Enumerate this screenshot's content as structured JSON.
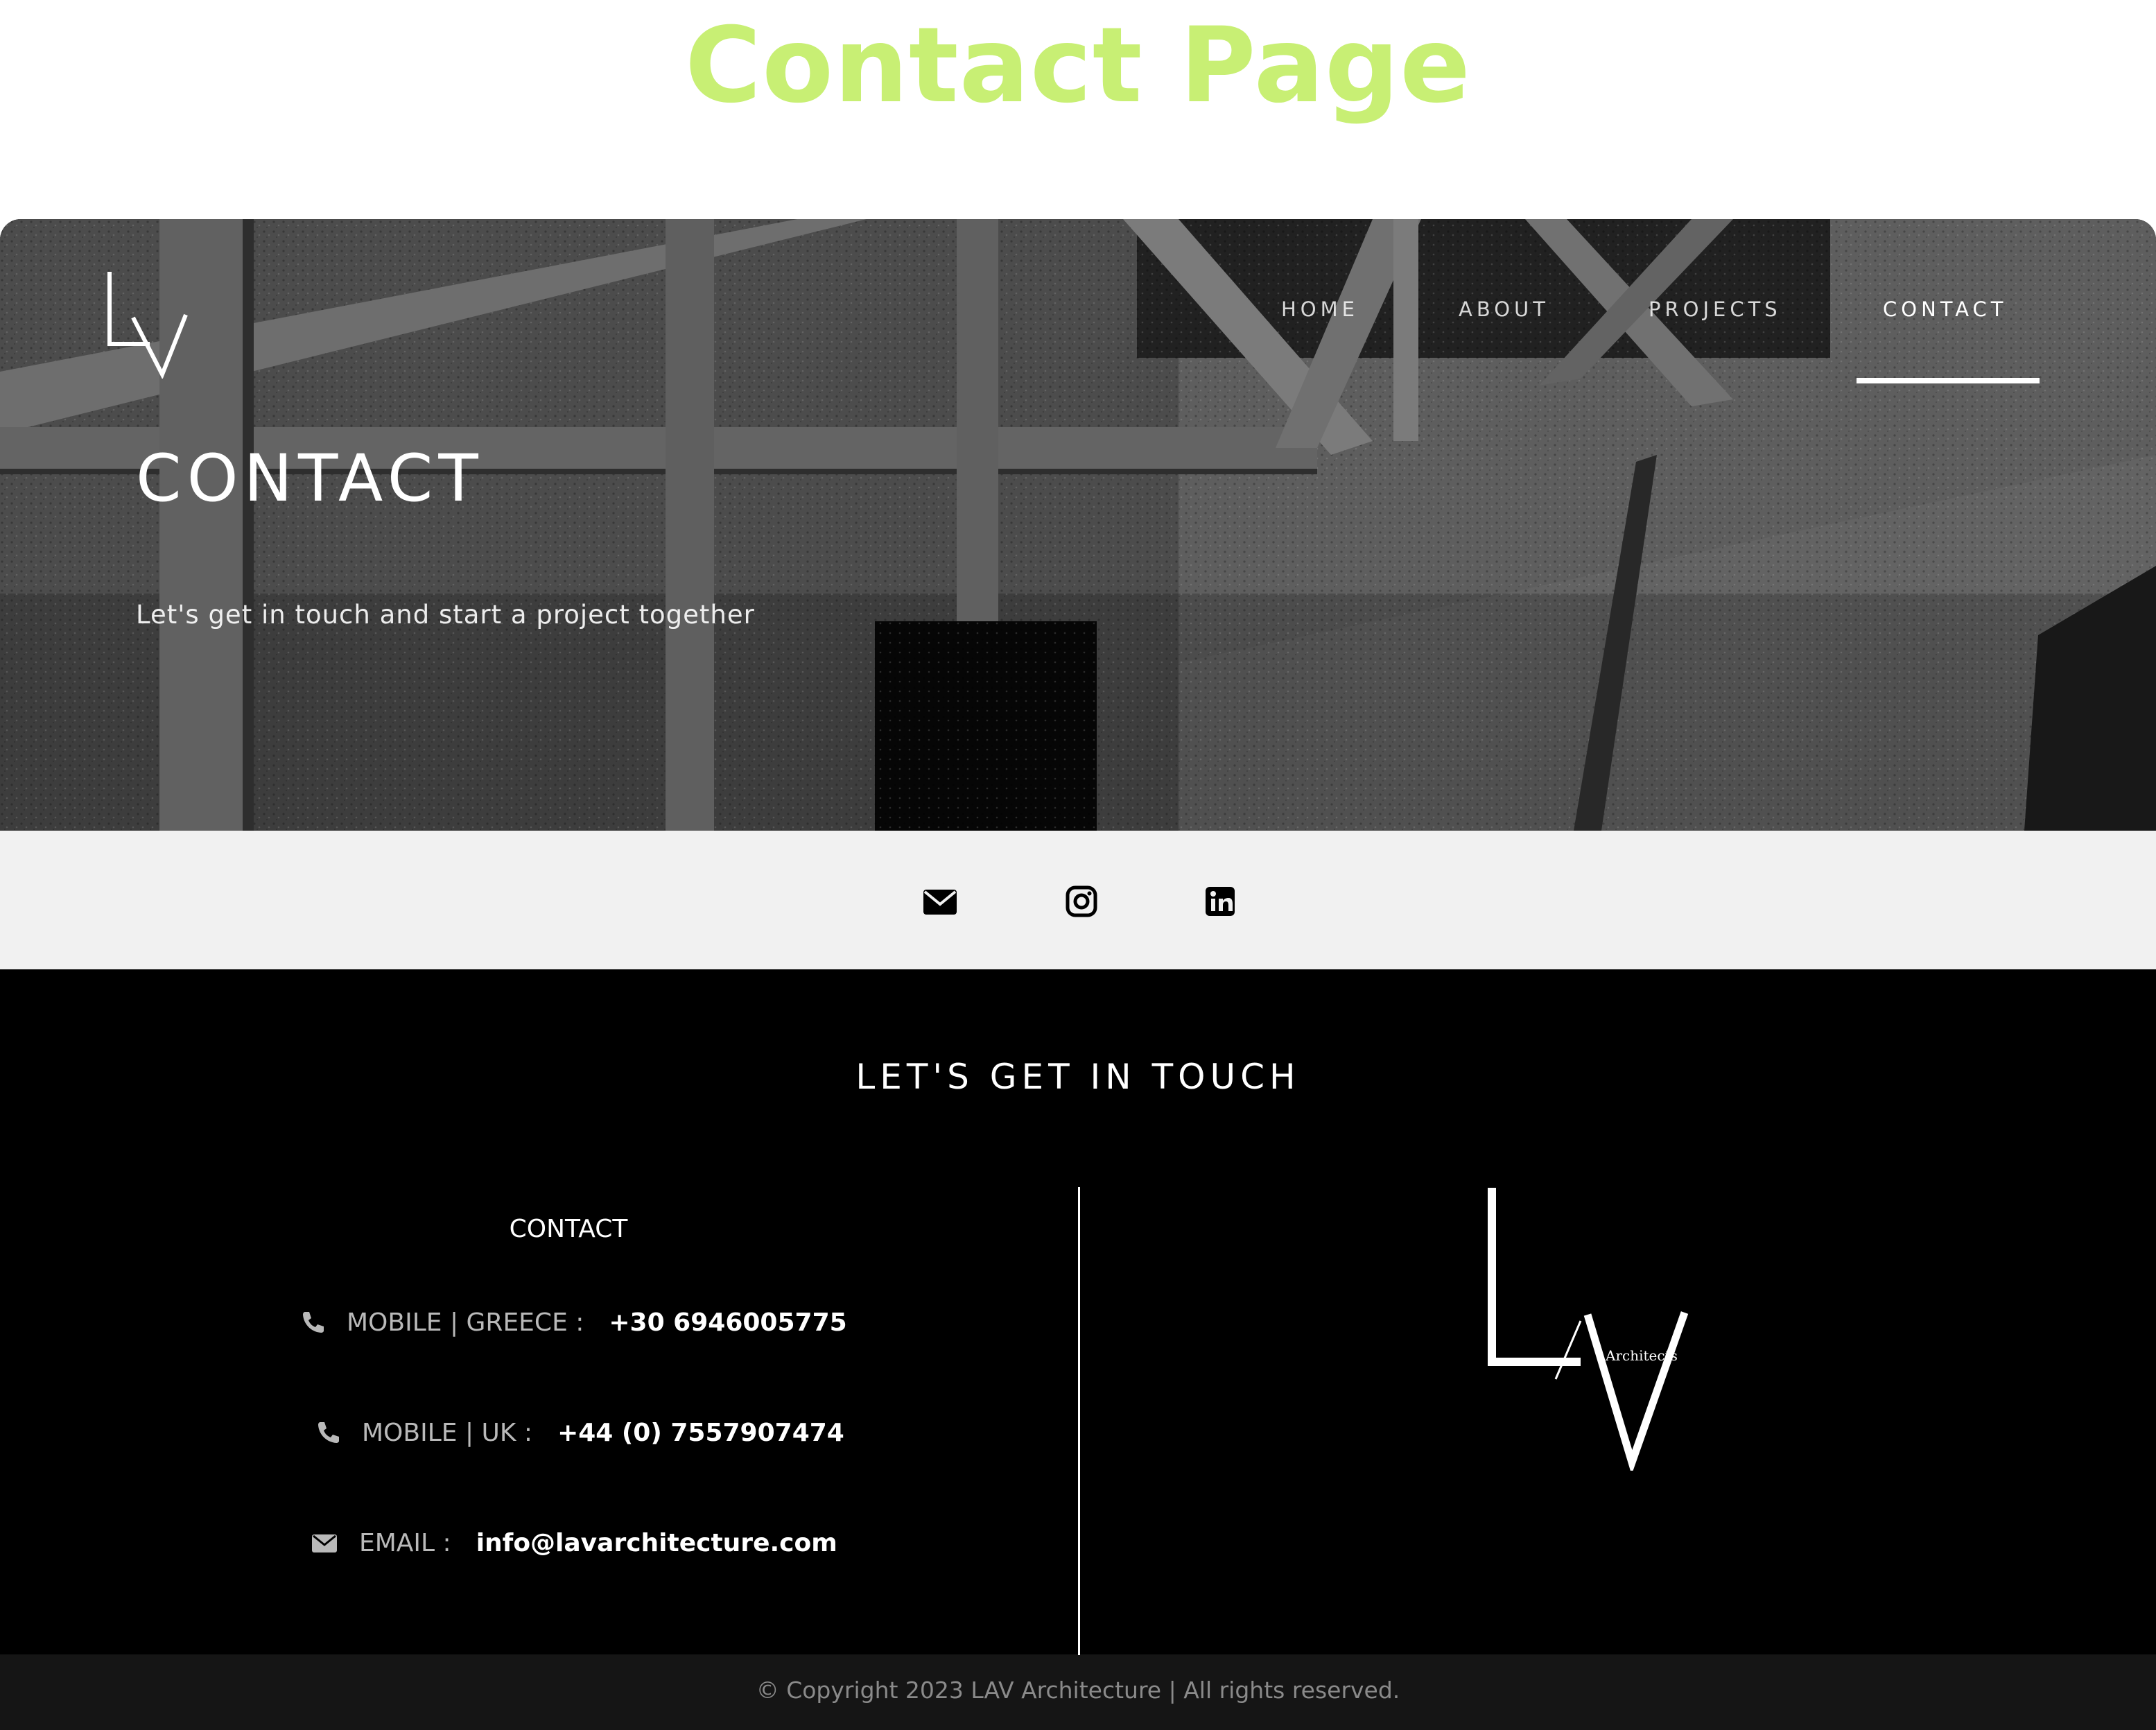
{
  "page_heading": "Contact Page",
  "brand": {
    "logo_letters": "LV",
    "logo_subtext": "Architects"
  },
  "nav": {
    "items": [
      {
        "label": "HOME"
      },
      {
        "label": "ABOUT"
      },
      {
        "label": "PROJECTS"
      },
      {
        "label": "CONTACT",
        "active": true
      }
    ]
  },
  "hero": {
    "title": "CONTACT",
    "subtitle": "Let's get in touch and start a project together"
  },
  "social": {
    "icons": [
      "envelope-icon",
      "instagram-icon",
      "linkedin-icon"
    ]
  },
  "contact": {
    "heading": "LET'S GET IN TOUCH",
    "column_title": "CONTACT",
    "rows": [
      {
        "icon": "phone-icon",
        "label": "MOBILE | GREECE :",
        "value": "+30 6946005775"
      },
      {
        "icon": "phone-icon",
        "label": "MOBILE | UK :",
        "value": "+44 (0) 7557907474"
      },
      {
        "icon": "envelope-icon",
        "label": "EMAIL :",
        "value": "info@lavarchitecture.com"
      }
    ]
  },
  "footer": {
    "text": "© Copyright 2023  LAV Architecture | All rights reserved."
  },
  "colors": {
    "heading_green": "#c8ef74",
    "hero_bg": "#6f6f6f",
    "social_bar_bg": "#f1f1f1",
    "section_bg": "#000000",
    "footer_bg": "#151515"
  }
}
